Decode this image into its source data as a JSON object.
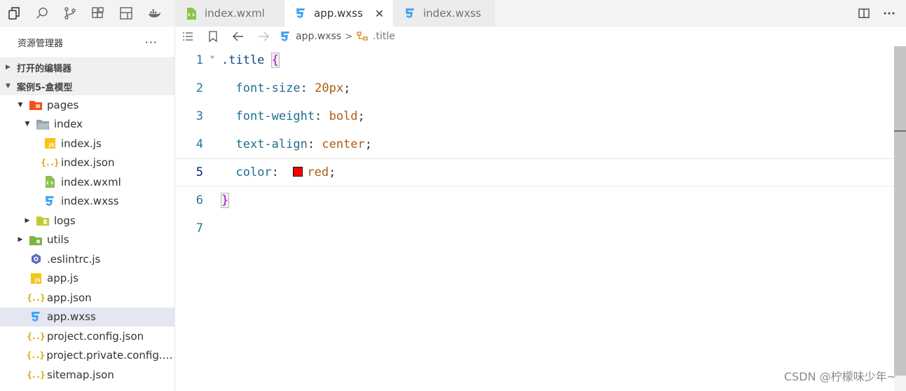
{
  "activity_bar": {
    "icons": [
      "explorer-icon",
      "search-icon",
      "source-control-icon",
      "extensions-icon",
      "layout-icon",
      "docker-icon"
    ]
  },
  "tabs": [
    {
      "label": "index.wxml",
      "icon": "wxml-file-icon",
      "active": false
    },
    {
      "label": "app.wxss",
      "icon": "wxss-file-icon",
      "active": true,
      "close": "✕"
    },
    {
      "label": "index.wxss",
      "icon": "wxss-file-icon",
      "active": false
    }
  ],
  "sidebar": {
    "title": "资源管理器",
    "more": "···",
    "sections": {
      "open_editors": "打开的编辑器",
      "project": "案例5-盒模型"
    },
    "tree": [
      {
        "label": "pages",
        "depth": 0,
        "twisty": "▼",
        "icon": "folder-pages-icon"
      },
      {
        "label": "index",
        "depth": 1,
        "twisty": "▼",
        "icon": "folder-open-icon"
      },
      {
        "label": "index.js",
        "depth": 2,
        "twisty": "",
        "icon": "js-file-icon"
      },
      {
        "label": "index.json",
        "depth": 2,
        "twisty": "",
        "icon": "json-file-icon"
      },
      {
        "label": "index.wxml",
        "depth": 2,
        "twisty": "",
        "icon": "wxml-file-icon"
      },
      {
        "label": "index.wxss",
        "depth": 2,
        "twisty": "",
        "icon": "wxss-file-icon"
      },
      {
        "label": "logs",
        "depth": 1,
        "twisty": "▶",
        "icon": "folder-logs-icon"
      },
      {
        "label": "utils",
        "depth": 0,
        "twisty": "▶",
        "icon": "folder-utils-icon"
      },
      {
        "label": ".eslintrc.js",
        "depth": 0,
        "twisty": "",
        "icon": "eslint-file-icon"
      },
      {
        "label": "app.js",
        "depth": 0,
        "twisty": "",
        "icon": "js-file-icon"
      },
      {
        "label": "app.json",
        "depth": 0,
        "twisty": "",
        "icon": "json-file-icon"
      },
      {
        "label": "app.wxss",
        "depth": 0,
        "twisty": "",
        "icon": "wxss-file-icon",
        "selected": true
      },
      {
        "label": "project.config.json",
        "depth": 0,
        "twisty": "",
        "icon": "json-file-icon"
      },
      {
        "label": "project.private.config.js...",
        "depth": 0,
        "twisty": "",
        "icon": "json-file-icon"
      },
      {
        "label": "sitemap.json",
        "depth": 0,
        "twisty": "",
        "icon": "json-file-icon"
      }
    ]
  },
  "breadcrumb": {
    "file": "app.wxss",
    "separator": ">",
    "symbol": ".title"
  },
  "editor": {
    "current_line": 5,
    "lines": [
      {
        "n": "1",
        "fold": "⌄"
      },
      {
        "n": "2"
      },
      {
        "n": "3"
      },
      {
        "n": "4"
      },
      {
        "n": "5"
      },
      {
        "n": "6"
      },
      {
        "n": "7"
      }
    ],
    "code": {
      "selector": ".title",
      "open_brace": "{",
      "close_brace": "}",
      "p1_name": "font-size",
      "p1_value": "20px",
      "p2_name": "font-weight",
      "p2_value": "bold",
      "p3_name": "text-align",
      "p3_value": "center",
      "p4_name": "color",
      "p4_value": "red",
      "p4_swatch": "#ff0000",
      "colon": ":",
      "semicolon": ";"
    }
  },
  "watermark": "CSDN @柠檬味少年~",
  "colors": {
    "accent_wxss": "#42a5f5",
    "wxml": "#8bc34a",
    "js": "#f5c518",
    "json": "#d9a400",
    "pages_folder": "#f4511e",
    "selected_row": "#e4e6f1"
  }
}
